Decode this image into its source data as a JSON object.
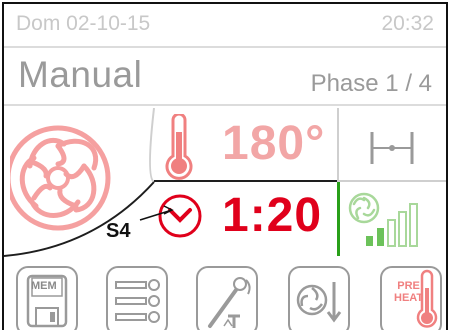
{
  "status": {
    "date": "Dom 02-10-15",
    "time": "20:32"
  },
  "mode": {
    "title": "Manual",
    "phase": "Phase 1 / 4"
  },
  "main": {
    "temperature": "180°",
    "time": "1:20",
    "step": "S4"
  },
  "toolbar": {
    "mem_label": "MEM",
    "preheat_label_line1": "PRE",
    "preheat_label_line2": "HEAT"
  },
  "colors": {
    "temp": "#f2a6a6",
    "time": "#e0001b",
    "fan": "#f5a0a0",
    "green": "#29a019",
    "light_green": "#a8d89a"
  },
  "icons": {
    "fan": "fan-icon",
    "thermometer": "thermometer-icon",
    "timer": "timer-x-icon",
    "phase_link": "phase-link-icon",
    "fan_speed": "fan-speed-icon",
    "mem": "mem-save-icon",
    "trays": "trays-timer-icon",
    "probe": "core-probe-icon",
    "cooldown": "fan-cooldown-icon",
    "preheat": "preheat-icon"
  }
}
